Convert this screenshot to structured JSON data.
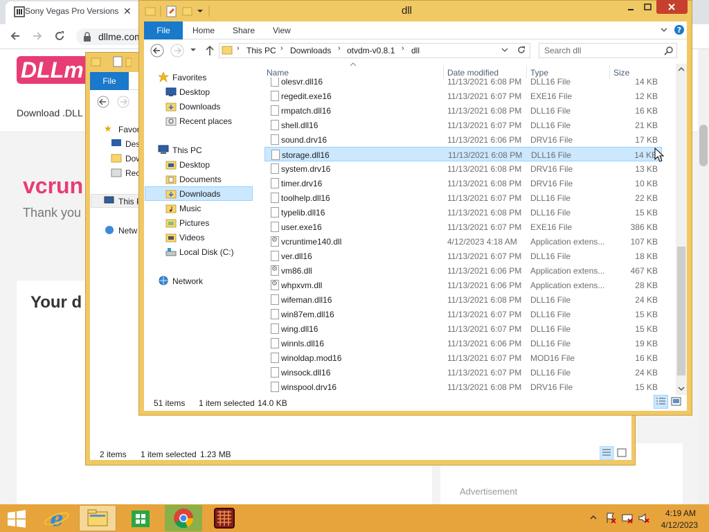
{
  "browser": {
    "tab_title": "Sony Vegas Pro Versions",
    "tab_close": "✕",
    "url": "dllme.com",
    "logo": "DLLm",
    "download_link": "Download .DLL",
    "heading": "vcrun",
    "thanks": "Thank you",
    "your_heading": "Your d",
    "advertisement": "Advertisement"
  },
  "back_window": {
    "file_tab": "File",
    "nav": [
      "Favor",
      "Des",
      "Dow",
      "Rec",
      "This P",
      "Netw"
    ],
    "status_count": "2 items",
    "status_selected": "1 item selected",
    "status_size": "1.23 MB"
  },
  "window": {
    "title": "dll",
    "ribbon": {
      "file": "File",
      "home": "Home",
      "share": "Share",
      "view": "View"
    },
    "breadcrumb": [
      "This PC",
      "Downloads",
      "otvdm-v0.8.1",
      "dll"
    ],
    "search_placeholder": "Search dll",
    "nav": {
      "favorites": "Favorites",
      "fav_items": [
        "Desktop",
        "Downloads",
        "Recent places"
      ],
      "this_pc": "This PC",
      "pc_items": [
        "Desktop",
        "Documents",
        "Downloads",
        "Music",
        "Pictures",
        "Videos",
        "Local Disk (C:)"
      ],
      "network": "Network"
    },
    "columns": {
      "name": "Name",
      "date": "Date modified",
      "type": "Type",
      "size": "Size"
    },
    "partial_row": {
      "name": "olesvr.dll16",
      "date": "11/13/2021 6:08 PM",
      "type": "DLL16 File",
      "size": "14 KB"
    },
    "files": [
      {
        "name": "regedit.exe16",
        "date": "11/13/2021 6:07 PM",
        "type": "EXE16 File",
        "size": "12 KB",
        "icon": "file"
      },
      {
        "name": "rmpatch.dll16",
        "date": "11/13/2021 6:08 PM",
        "type": "DLL16 File",
        "size": "16 KB",
        "icon": "file"
      },
      {
        "name": "shell.dll16",
        "date": "11/13/2021 6:07 PM",
        "type": "DLL16 File",
        "size": "21 KB",
        "icon": "file"
      },
      {
        "name": "sound.drv16",
        "date": "11/13/2021 6:06 PM",
        "type": "DRV16 File",
        "size": "17 KB",
        "icon": "file"
      },
      {
        "name": "storage.dll16",
        "date": "11/13/2021 6:08 PM",
        "type": "DLL16 File",
        "size": "14 KB",
        "icon": "file",
        "selected": true
      },
      {
        "name": "system.drv16",
        "date": "11/13/2021 6:08 PM",
        "type": "DRV16 File",
        "size": "13 KB",
        "icon": "file"
      },
      {
        "name": "timer.drv16",
        "date": "11/13/2021 6:08 PM",
        "type": "DRV16 File",
        "size": "10 KB",
        "icon": "file"
      },
      {
        "name": "toolhelp.dll16",
        "date": "11/13/2021 6:07 PM",
        "type": "DLL16 File",
        "size": "22 KB",
        "icon": "file"
      },
      {
        "name": "typelib.dll16",
        "date": "11/13/2021 6:08 PM",
        "type": "DLL16 File",
        "size": "15 KB",
        "icon": "file"
      },
      {
        "name": "user.exe16",
        "date": "11/13/2021 6:07 PM",
        "type": "EXE16 File",
        "size": "386 KB",
        "icon": "file"
      },
      {
        "name": "vcruntime140.dll",
        "date": "4/12/2023 4:18 AM",
        "type": "Application extens...",
        "size": "107 KB",
        "icon": "gear"
      },
      {
        "name": "ver.dll16",
        "date": "11/13/2021 6:07 PM",
        "type": "DLL16 File",
        "size": "18 KB",
        "icon": "file"
      },
      {
        "name": "vm86.dll",
        "date": "11/13/2021 6:06 PM",
        "type": "Application extens...",
        "size": "467 KB",
        "icon": "gear"
      },
      {
        "name": "whpxvm.dll",
        "date": "11/13/2021 6:06 PM",
        "type": "Application extens...",
        "size": "28 KB",
        "icon": "gear"
      },
      {
        "name": "wifeman.dll16",
        "date": "11/13/2021 6:08 PM",
        "type": "DLL16 File",
        "size": "24 KB",
        "icon": "file"
      },
      {
        "name": "win87em.dll16",
        "date": "11/13/2021 6:07 PM",
        "type": "DLL16 File",
        "size": "15 KB",
        "icon": "file"
      },
      {
        "name": "wing.dll16",
        "date": "11/13/2021 6:07 PM",
        "type": "DLL16 File",
        "size": "15 KB",
        "icon": "file"
      },
      {
        "name": "winnls.dll16",
        "date": "11/13/2021 6:06 PM",
        "type": "DLL16 File",
        "size": "19 KB",
        "icon": "file"
      },
      {
        "name": "winoldap.mod16",
        "date": "11/13/2021 6:07 PM",
        "type": "MOD16 File",
        "size": "16 KB",
        "icon": "file"
      },
      {
        "name": "winsock.dll16",
        "date": "11/13/2021 6:07 PM",
        "type": "DLL16 File",
        "size": "24 KB",
        "icon": "file"
      },
      {
        "name": "winspool.drv16",
        "date": "11/13/2021 6:08 PM",
        "type": "DRV16 File",
        "size": "15 KB",
        "icon": "file"
      }
    ],
    "status_count": "51 items",
    "status_selected": "1 item selected",
    "status_size": "14.0 KB"
  },
  "taskbar": {
    "time": "4:19 AM",
    "date": "4/12/2023"
  },
  "colors": {
    "frame": "#f0c864",
    "accent": "#1979ca",
    "selection": "#cce8ff",
    "taskbar": "#e7a43c",
    "brand": "#e83c74"
  }
}
